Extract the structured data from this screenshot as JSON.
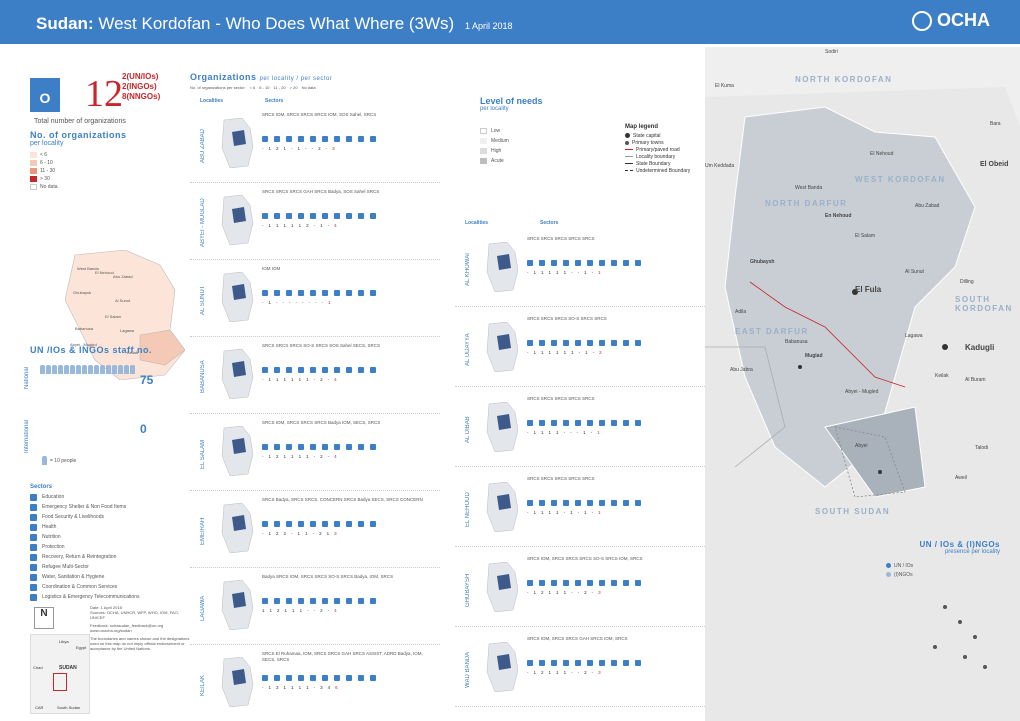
{
  "header": {
    "country": "Sudan:",
    "title": "West Kordofan - Who Does What Where (3Ws)",
    "date": "1 April 2018",
    "logo": "OCHA"
  },
  "kpi": {
    "icon_letter": "O",
    "total": "12",
    "un_ios": "2(UN/IOs)",
    "ingos": "2(INGOs)",
    "nngos": "8(NNGOs)",
    "label": "Total number of organizations"
  },
  "orgs_section": {
    "title": "No. of organizations",
    "subtitle": "per locality",
    "legend": [
      "< 6",
      "6 - 10",
      "11 - 30",
      "> 30",
      "No data"
    ]
  },
  "map1_localities": [
    "West Banda",
    "El Nehoud",
    "Abu Zabad",
    "Ghubaysh",
    "Al Sunut",
    "El Salam",
    "Babanusa",
    "Lagawa",
    "Abyei - Mugled",
    "Keilak"
  ],
  "staff": {
    "title": "UN /IOs & INGOs staff no.",
    "national_label": "National",
    "national_count": "75",
    "international_label": "International",
    "international_count": "0",
    "people_key": "= 10 people"
  },
  "sectors": {
    "title": "Sectors",
    "items": [
      "Education",
      "Emergency Shelter & Non Food Items",
      "Food Security & Livelihoods",
      "Health",
      "Nutrition",
      "Protection",
      "Recovery, Return & Reintegration",
      "Refugee Multi-Sector",
      "Water, Sanitation & Hygiene",
      "Coordination & Common Services",
      "Logistics & Emergency Telecommunications"
    ]
  },
  "orgs_header": {
    "title": "Organizations",
    "subtitle": "per locality / per sector",
    "key_label": "No. of organizations per sector:",
    "key": [
      "< 6",
      "6 - 10",
      "11 - 20",
      "> 20",
      "No data"
    ],
    "col_localities": "Localities",
    "col_sectors": "Sectors"
  },
  "left_rows": [
    {
      "loc": "ABU ZABAD",
      "text": "SRCS  IOM, SRCS  SRCS  SRCS  IOM, SOS Sahel, SRCS",
      "nums": [
        "-",
        "1",
        "2",
        "1",
        "-",
        "1",
        "-",
        "-",
        "2",
        "-",
        "3"
      ]
    },
    {
      "loc": "ABYEI - MUGLAD",
      "text": "SRCS  SRCS  SRCS  GAH  SRCS  Badya, SOS Sahel  SRCS",
      "nums": [
        "-",
        "1",
        "1",
        "1",
        "1",
        "1",
        "2",
        "-",
        "1",
        "-",
        "4"
      ]
    },
    {
      "loc": "AL SUNUT",
      "text": "IOM  IOM",
      "nums": [
        "-",
        "1",
        "-",
        "-",
        "-",
        "-",
        "-",
        "-",
        "-",
        "-",
        "1"
      ]
    },
    {
      "loc": "BABANUSA",
      "text": "SRCS  SRCS  SRCS  SO-S  SRCS  SOS Sahel  SECS, SRCS",
      "nums": [
        "-",
        "1",
        "1",
        "1",
        "1",
        "1",
        "1",
        "-",
        "2",
        "-",
        "4"
      ]
    },
    {
      "loc": "EL SALAM",
      "text": "SRCS  IOM, SRCS  SRCS  SRCS  Badya  IOM, SECS, SRCS",
      "nums": [
        "-",
        "1",
        "2",
        "1",
        "1",
        "1",
        "1",
        "-",
        "2",
        "-",
        "4"
      ]
    },
    {
      "loc": "EMEIRAH",
      "text": "SRCS  Badya, SRCS  SRCS, CONCERN  SRCS  Badya  SECS, SRCS  CONCERN",
      "nums": [
        "-",
        "1",
        "2",
        "2",
        "-",
        "1",
        "1",
        "-",
        "2",
        "1",
        "3"
      ]
    },
    {
      "loc": "LAGAWA",
      "text": "Badya  SRCS  IOM, SRCS  SRCS  SO-S  SRCS  Badya, IOM, SRCS",
      "nums": [
        "1",
        "1",
        "2",
        "1",
        "1",
        "1",
        "-",
        "-",
        "2",
        "-",
        "4"
      ]
    },
    {
      "loc": "KEILAK",
      "text": "SRCS  El Ruhamaa, IOM, SRCS  SRCS  GAH  SRCS  ASSIST, ADRD  Badya, IOM, SECS, SRCS",
      "nums": [
        "-",
        "1",
        "3",
        "1",
        "1",
        "1",
        "1",
        "-",
        "3",
        "4",
        "6"
      ]
    }
  ],
  "right_head": {
    "col_localities": "Localities",
    "col_sectors": "Sectors"
  },
  "right_rows": [
    {
      "loc": "AL KHOWAI",
      "text": "SRCS  SRCS  SRCS  SRCS  SRCS",
      "nums": [
        "-",
        "1",
        "1",
        "1",
        "1",
        "1",
        "-",
        "-",
        "1",
        "-",
        "1"
      ]
    },
    {
      "loc": "AL UDAYYA",
      "text": "SRCS  SRCS  SRCS  SO-S  SRCS  SRCS",
      "nums": [
        "-",
        "1",
        "1",
        "1",
        "1",
        "1",
        "1",
        "-",
        "1",
        "-",
        "2"
      ]
    },
    {
      "loc": "AL DIBAB",
      "text": "SRCS  SRCS  SRCS  SRCS  SRCS",
      "nums": [
        "-",
        "1",
        "1",
        "1",
        "1",
        "-",
        "-",
        "-",
        "1",
        "-",
        "1"
      ]
    },
    {
      "loc": "EL NEHOUD",
      "text": "SRCS  SRCS  SRCS  SRCS  SRCS",
      "nums": [
        "-",
        "1",
        "1",
        "1",
        "1",
        "-",
        "1",
        "-",
        "1",
        "-",
        "1"
      ]
    },
    {
      "loc": "GHUBAYSH",
      "text": "SRCS  IOM, SRCS  SRCS  SRCS  SO-S  SRCS  IOM, SRCS",
      "nums": [
        "-",
        "1",
        "2",
        "1",
        "1",
        "1",
        "-",
        "-",
        "2",
        "-",
        "3"
      ]
    },
    {
      "loc": "WAD BANDA",
      "text": "SRCS  IOM, SRCS  SRCS  GAH  SRCS  IOM, SRCS",
      "nums": [
        "-",
        "1",
        "2",
        "1",
        "1",
        "1",
        "-",
        "-",
        "2",
        "-",
        "3"
      ]
    }
  ],
  "needs": {
    "title": "Level of needs",
    "subtitle": "per locality",
    "levels": [
      "Low",
      "Medium",
      "High",
      "Acute"
    ]
  },
  "map_legend": {
    "title": "Map legend",
    "items": [
      "State capital",
      "Primary towns",
      "Primary/paved road",
      "Locality boundary",
      "State Boundary",
      "Undetermined Boundary"
    ]
  },
  "map": {
    "regions": [
      "NORTH KORDOFAN",
      "NORTH DARFUR",
      "WEST KORDOFAN",
      "SOUTH KORDOFAN",
      "EAST DARFUR",
      "SOUTH SUDAN",
      "Sodiri"
    ],
    "towns": [
      "El Kuma",
      "Bara",
      "El Nehoud",
      "Um Keddada",
      "West Banda",
      "Abu Zabad",
      "En Nehoud",
      "El Salam",
      "Ghubaysh",
      "Al Sunut",
      "Dilling",
      "Adila",
      "El Fula",
      "Babanusa",
      "Lagawa",
      "Muglad",
      "Kadugli",
      "Keilak",
      "Abu Jabra",
      "Abyei - Mugled",
      "Abyei",
      "Al Buram",
      "Aweil",
      "Talodi",
      "Kadugli",
      "El Obeid"
    ]
  },
  "presence": {
    "title": "UN / IOs & (I)NGOs",
    "subtitle": "presence per locality",
    "items": [
      "UN / IOs",
      "(I)NGOs"
    ]
  },
  "footer": {
    "date": "Date: 1 April 2018",
    "sources": "Sources: OCHA, UNHCR, WFP, WHO, IOM, FAO, UNICEF",
    "feedback": "Feedback: ochasudan_feedback@un.org",
    "web": "www.unocha.org/sudan",
    "disclaimer": "The boundaries and names shown and the designations used on this map do not imply official endorsement or acceptance by the United Nations."
  },
  "inset_labels": [
    "Libya",
    "Egypt",
    "Chad",
    "SUDAN",
    "CAR",
    "South Sudan"
  ],
  "colors": {
    "primary": "#3d7fc6",
    "accent": "#c7262b",
    "pale": "#f4c9b6"
  }
}
